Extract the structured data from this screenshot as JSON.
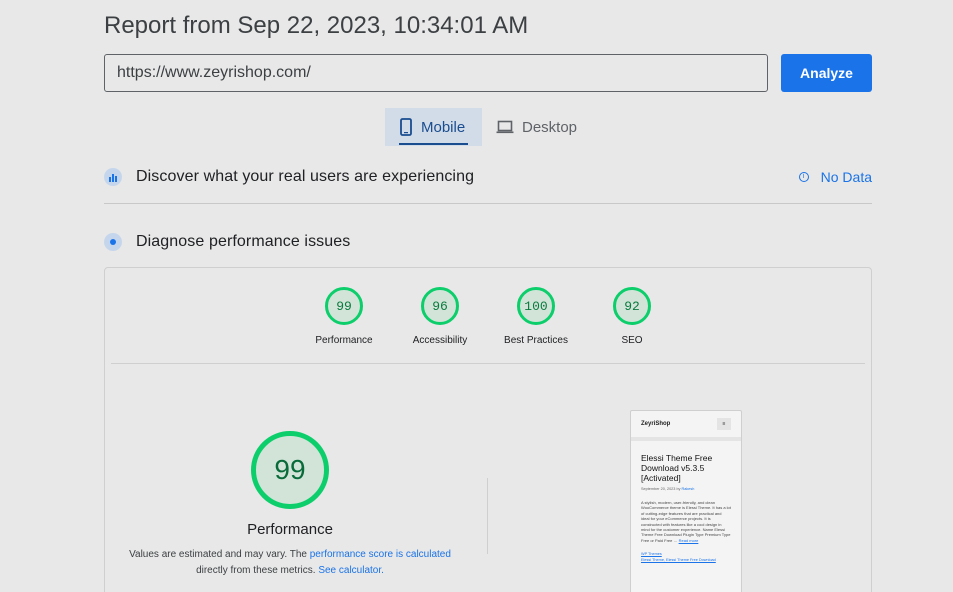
{
  "header": {
    "title": "Report from Sep 22, 2023, 10:34:01 AM"
  },
  "search": {
    "url_value": "https://www.zeyrishop.com/",
    "analyze_label": "Analyze"
  },
  "tabs": [
    {
      "label": "Mobile",
      "active": true
    },
    {
      "label": "Desktop",
      "active": false
    }
  ],
  "field_data": {
    "heading": "Discover what your real users are experiencing",
    "status": "No Data"
  },
  "diagnose": {
    "heading": "Diagnose performance issues"
  },
  "scores": [
    {
      "label": "Performance",
      "value": "99"
    },
    {
      "label": "Accessibility",
      "value": "96"
    },
    {
      "label": "Best Practices",
      "value": "100"
    },
    {
      "label": "SEO",
      "value": "92"
    }
  ],
  "main_score": {
    "value": "99",
    "label": "Performance",
    "note_prefix": "Values are estimated and may vary. The ",
    "note_link1": "performance score is calculated",
    "note_middle": "directly from these metrics. ",
    "note_link2": "See calculator."
  },
  "screenshot": {
    "site_name": "ZeyriShop",
    "menu_glyph": "≡",
    "title": "Elessi Theme Free Download v5.3.5 [Activated]",
    "date_prefix": "September 20, 2023 by ",
    "author": "Rakesh",
    "body": "A stylish, modern, user-friendly, and clean WooCommerce theme is Elessi Theme. It has a lot of cutting-edge features that are practical and ideal for your eCommerce projects. It is constructed with features like a cool design in mind for the customer experience. Name Elessi Theme Free Download Plugin Type Premium Type Free or Paid Free … ",
    "read_more": "Read more",
    "category": "WP Themes",
    "tags": "Elessi Theme, Elessi Theme Free Download"
  },
  "colors": {
    "accent": "#1a73e8",
    "pass": "#0cce6b"
  }
}
